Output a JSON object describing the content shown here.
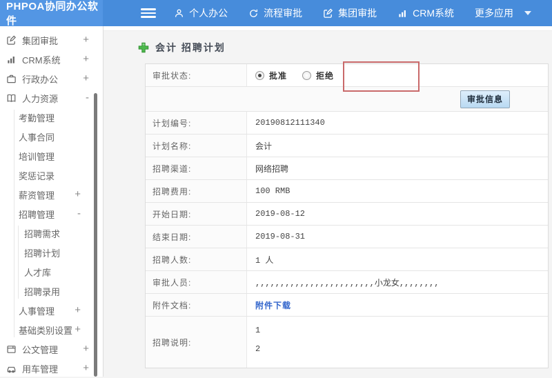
{
  "header": {
    "logo": "PHPOA协同办公软件",
    "nav": [
      {
        "label": "个人办公",
        "icon": "user-icon"
      },
      {
        "label": "流程审批",
        "icon": "process-icon"
      },
      {
        "label": "集团审批",
        "icon": "edit-icon"
      },
      {
        "label": "CRM系统",
        "icon": "bar-chart-icon"
      },
      {
        "label": "更多应用",
        "icon": "caret-down-icon"
      }
    ]
  },
  "sidebar": {
    "items": [
      {
        "label": "集团审批",
        "icon": "edit-icon",
        "expand": "+"
      },
      {
        "label": "CRM系统",
        "icon": "bar-chart-icon",
        "expand": "+"
      },
      {
        "label": "行政办公",
        "icon": "briefcase-icon",
        "expand": "+"
      },
      {
        "label": "人力资源",
        "icon": "book-icon",
        "expand": "-"
      },
      {
        "label": "考勤管理"
      },
      {
        "label": "人事合同"
      },
      {
        "label": "培训管理"
      },
      {
        "label": "奖惩记录"
      },
      {
        "label": "薪资管理",
        "expand": "+"
      },
      {
        "label": "招聘管理",
        "expand": "-"
      },
      {
        "label": "招聘需求"
      },
      {
        "label": "招聘计划"
      },
      {
        "label": "人才库"
      },
      {
        "label": "招聘录用"
      },
      {
        "label": "人事管理",
        "expand": "+"
      },
      {
        "label": "基础类别设置",
        "expand": "+"
      },
      {
        "label": "公文管理",
        "icon": "document-icon",
        "expand": "+"
      },
      {
        "label": "用车管理",
        "icon": "car-icon",
        "expand": "+"
      }
    ]
  },
  "main": {
    "title": "会计 招聘计划",
    "approval": {
      "label": "审批状态:",
      "options": [
        {
          "label": "批准",
          "checked": true
        },
        {
          "label": "拒绝",
          "checked": false
        }
      ],
      "button": "审批信息"
    },
    "fields": [
      {
        "label": "计划编号:",
        "value": "20190812111340"
      },
      {
        "label": "计划名称:",
        "value": "会计"
      },
      {
        "label": "招聘渠道:",
        "value": "网络招聘"
      },
      {
        "label": "招聘费用:",
        "value": "100 RMB"
      },
      {
        "label": "开始日期:",
        "value": "2019-08-12"
      },
      {
        "label": "结束日期:",
        "value": "2019-08-31"
      },
      {
        "label": "招聘人数:",
        "value": "1 人"
      },
      {
        "label": "审批人员:",
        "value": ",,,,,,,,,,,,,,,,,,,,,,,,小龙女,,,,,,,,"
      },
      {
        "label": "附件文档:",
        "value": "附件下载",
        "type": "link"
      },
      {
        "label": "招聘说明:",
        "type": "multiline",
        "lines": [
          "1",
          "2"
        ]
      }
    ]
  },
  "colors": {
    "header_blue": "#478cdb",
    "logo_blue": "#5396e4",
    "highlight_red": "#c9696a",
    "link_blue": "#3366cc",
    "button_blue": "#b9d9f2",
    "plus_green": "#4db84d"
  }
}
